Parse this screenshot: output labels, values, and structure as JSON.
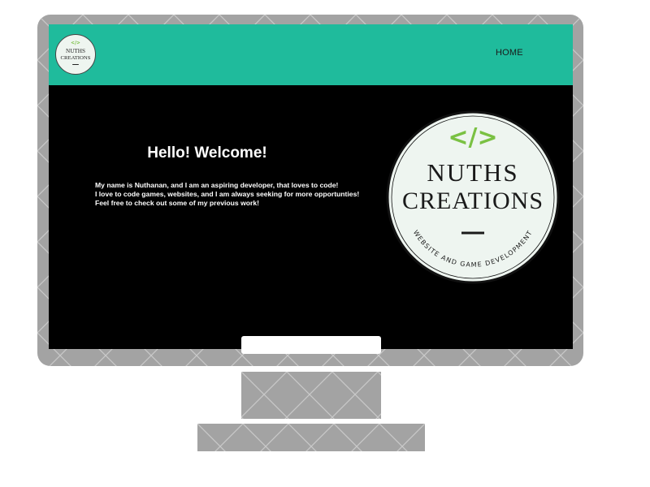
{
  "colors": {
    "frame": "#a3a3a3",
    "navbar": "#1fbb9c",
    "screen_bg": "#000000",
    "logo_bg": "#eef5f0",
    "code_icon": "#7ac143"
  },
  "nav": {
    "logo": {
      "line1": "NUTHS",
      "line2": "CREATIONS",
      "icon": "code-icon"
    },
    "home_label": "HOME"
  },
  "hero": {
    "title": "Hello! Welcome!",
    "lines": [
      "My name is Nuthanan, and I am an aspiring developer, that loves to code!",
      "I love to code games, websites, and I am always seeking for more opportunties!",
      "Feel free to check out some of my previous work!"
    ]
  },
  "logo": {
    "code_symbol": "</>",
    "line1": "NUTHS",
    "line2": "CREATIONS",
    "tagline": "WEBSITE AND GAME DEVELOPMENT"
  }
}
